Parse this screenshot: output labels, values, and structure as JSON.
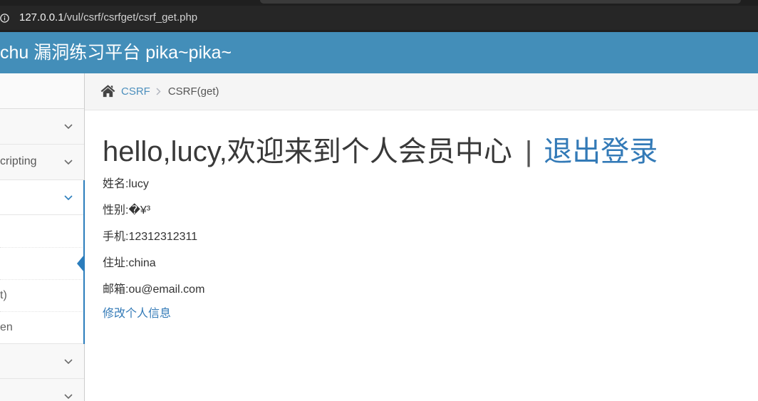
{
  "browser": {
    "security_icon": "info-icon",
    "url_host": "127.0.0.1",
    "url_path": "/vul/csrf/csrfget/csrf_get.php"
  },
  "header": {
    "title": "chu 漏洞练习平台 pika~pika~"
  },
  "sidebar": {
    "toggle_icon": "chevron-down-icon",
    "active_marker_icon": "caret-left-icon",
    "items": [
      {
        "expanded": false
      },
      {
        "label": "cripting",
        "expanded": false
      },
      {
        "expanded": true,
        "active": true,
        "children": [
          {
            "active": false
          },
          {
            "active": true
          },
          {
            "label": "t)",
            "active": false
          },
          {
            "label": "en",
            "active": false
          }
        ]
      },
      {
        "expanded": false
      },
      {
        "expanded": false
      }
    ]
  },
  "breadcrumb": {
    "home_icon": "home-icon",
    "separator_icon": "chevron-right-icon",
    "items": [
      {
        "label": "CSRF",
        "link": true
      },
      {
        "label": "CSRF(get)",
        "link": false
      }
    ]
  },
  "main": {
    "greeting": "hello,lucy,欢迎来到个人会员中心",
    "separator": "|",
    "logout_label": "退出登录",
    "profile": [
      {
        "label": "姓名:",
        "value": "lucy"
      },
      {
        "label": "性别:",
        "value": "�¥³"
      },
      {
        "label": "手机:",
        "value": "12312312311"
      },
      {
        "label": "住址:",
        "value": "china"
      },
      {
        "label": "邮箱:",
        "value": "ou@email.com"
      }
    ],
    "edit_profile_label": "修改个人信息"
  },
  "colors": {
    "header_bg": "#438eb9",
    "link": "#337ab7",
    "breadcrumb_link": "#4c8fbd",
    "sidebar_active": "#2b7dbc"
  }
}
